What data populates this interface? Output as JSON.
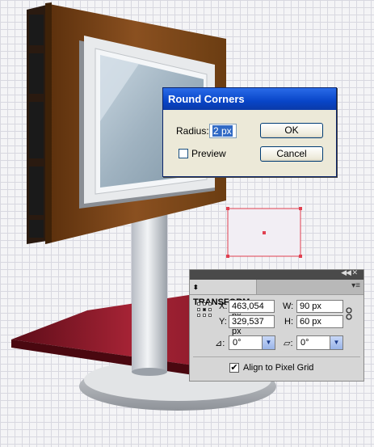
{
  "round_corners_dialog": {
    "title": "Round Corners",
    "radius_label": "Radius:",
    "radius_value": "2 px",
    "preview_label": "Preview",
    "preview_checked": false,
    "ok_label": "OK",
    "cancel_label": "Cancel"
  },
  "transform_panel": {
    "tab_label": "TRANSFORM",
    "x_label": "X:",
    "x_value": "463,054 px",
    "y_label": "Y:",
    "y_value": "329,537 px",
    "w_label": "W:",
    "w_value": "90 px",
    "h_label": "H:",
    "h_value": "60 px",
    "rotate_value": "0°",
    "shear_value": "0°",
    "align_label": "Align to Pixel Grid",
    "align_checked": true
  },
  "colors": {
    "frame_brown": "#6b3d12",
    "shelf_red": "#8e1a2a",
    "title_bar_blue": "#0845c8",
    "selection_red": "#e04050"
  }
}
